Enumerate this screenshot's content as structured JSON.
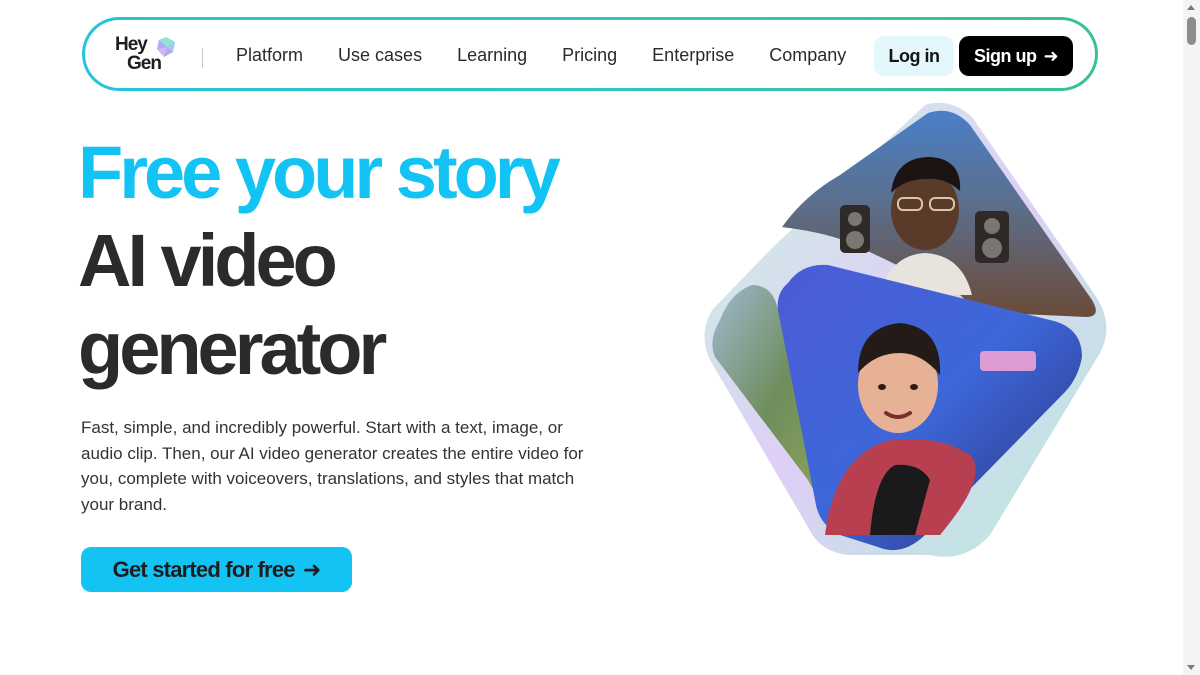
{
  "brand": {
    "logo_line1": "Hey",
    "logo_line2": "Gen"
  },
  "nav": {
    "links": [
      "Platform",
      "Use cases",
      "Learning",
      "Pricing",
      "Enterprise",
      "Company"
    ],
    "login_label": "Log in",
    "signup_label": "Sign up",
    "signup_icon": "arrow-right-icon"
  },
  "hero": {
    "headline_line1": "Free your story",
    "headline_line2": "AI video",
    "headline_line3": "generator",
    "description": "Fast, simple, and incredibly powerful. Start with a text, image, or audio clip. Then, our AI video generator creates the entire video for you, complete with voiceovers, translations, and styles that match your brand.",
    "cta_label": "Get started for free",
    "cta_icon": "arrow-right-icon"
  },
  "colors": {
    "accent": "#12c3f4",
    "text": "#2b2b2b",
    "nav_border_start": "#25c3d9",
    "nav_border_end": "#39c28a",
    "login_bg": "#e3f7fc",
    "signup_bg": "#000000"
  }
}
